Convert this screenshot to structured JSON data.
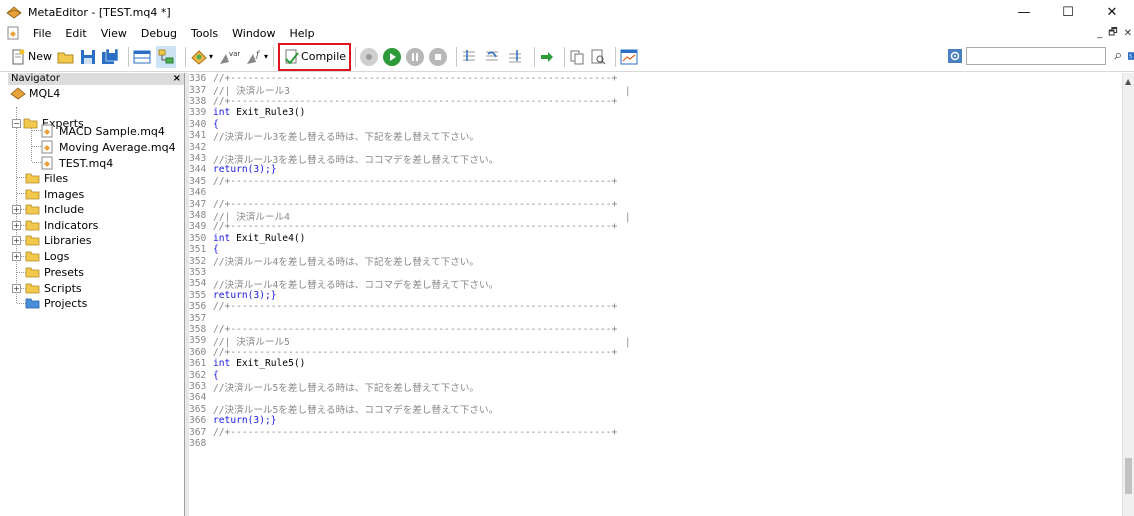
{
  "window": {
    "title": "MetaEditor - [TEST.mq4 *]",
    "controls": {
      "minimize": "—",
      "maximize": "☐",
      "close": "✕"
    }
  },
  "menu": {
    "items": [
      "File",
      "Edit",
      "View",
      "Debug",
      "Tools",
      "Window",
      "Help"
    ],
    "mdi": {
      "minimize": "_",
      "restore": "🗗",
      "close": "✕"
    }
  },
  "toolbar": {
    "new_label": "New",
    "compile_label": "Compile",
    "highlight_color": "#e0141e",
    "search_placeholder": ""
  },
  "navigator": {
    "title": "Navigator",
    "close": "×",
    "root": "MQL4",
    "folders": {
      "experts": "Experts",
      "files": "Files",
      "images": "Images",
      "include": "Include",
      "indicators": "Indicators",
      "libraries": "Libraries",
      "logs": "Logs",
      "presets": "Presets",
      "scripts": "Scripts",
      "projects": "Projects"
    },
    "expert_files": [
      "MACD Sample.mq4",
      "Moving Average.mq4",
      "TEST.mq4"
    ]
  },
  "editor": {
    "lines": [
      {
        "n": "336",
        "kind": "comment",
        "text": "//+------------------------------------------------------------------+"
      },
      {
        "n": "337",
        "kind": "comment_jp",
        "text": "//| 決済ルール3                                                          |"
      },
      {
        "n": "338",
        "kind": "comment",
        "text": "//+------------------------------------------------------------------+"
      },
      {
        "n": "339",
        "kind": "code",
        "kw": "int",
        "text": " Exit_Rule3()"
      },
      {
        "n": "340",
        "kind": "brace",
        "text": "{"
      },
      {
        "n": "341",
        "kind": "comment_jp",
        "text": "//決済ルール3を差し替える時は、下記を差し替えて下さい。"
      },
      {
        "n": "342",
        "kind": "blank",
        "text": ""
      },
      {
        "n": "343",
        "kind": "comment_jp",
        "text": "//決済ルール3を差し替える時は、ココマデを差し替えて下さい。"
      },
      {
        "n": "344",
        "kind": "return",
        "text": "return(3);}"
      },
      {
        "n": "345",
        "kind": "comment",
        "text": "//+------------------------------------------------------------------+"
      },
      {
        "n": "346",
        "kind": "blank",
        "text": ""
      },
      {
        "n": "347",
        "kind": "comment",
        "text": "//+------------------------------------------------------------------+"
      },
      {
        "n": "348",
        "kind": "comment_jp",
        "text": "//| 決済ルール4                                                          |"
      },
      {
        "n": "349",
        "kind": "comment",
        "text": "//+------------------------------------------------------------------+"
      },
      {
        "n": "350",
        "kind": "code",
        "kw": "int",
        "text": " Exit_Rule4()"
      },
      {
        "n": "351",
        "kind": "brace",
        "text": "{"
      },
      {
        "n": "352",
        "kind": "comment_jp",
        "text": "//決済ルール4を差し替える時は、下記を差し替えて下さい。"
      },
      {
        "n": "353",
        "kind": "blank",
        "text": ""
      },
      {
        "n": "354",
        "kind": "comment_jp",
        "text": "//決済ルール4を差し替える時は、ココマデを差し替えて下さい。"
      },
      {
        "n": "355",
        "kind": "return",
        "text": "return(3);}"
      },
      {
        "n": "356",
        "kind": "comment",
        "text": "//+------------------------------------------------------------------+"
      },
      {
        "n": "357",
        "kind": "blank",
        "text": ""
      },
      {
        "n": "358",
        "kind": "comment",
        "text": "//+------------------------------------------------------------------+"
      },
      {
        "n": "359",
        "kind": "comment_jp",
        "text": "//| 決済ルール5                                                          |"
      },
      {
        "n": "360",
        "kind": "comment",
        "text": "//+------------------------------------------------------------------+"
      },
      {
        "n": "361",
        "kind": "code",
        "kw": "int",
        "text": " Exit_Rule5()"
      },
      {
        "n": "362",
        "kind": "brace",
        "text": "{"
      },
      {
        "n": "363",
        "kind": "comment_jp",
        "text": "//決済ルール5を差し替える時は、下記を差し替えて下さい。"
      },
      {
        "n": "364",
        "kind": "blank",
        "text": ""
      },
      {
        "n": "365",
        "kind": "comment_jp",
        "text": "//決済ルール5を差し替える時は、ココマデを差し替えて下さい。"
      },
      {
        "n": "366",
        "kind": "return",
        "text": "return(3);}"
      },
      {
        "n": "367",
        "kind": "comment",
        "text": "//+------------------------------------------------------------------+"
      },
      {
        "n": "368",
        "kind": "blank",
        "text": ""
      }
    ]
  }
}
